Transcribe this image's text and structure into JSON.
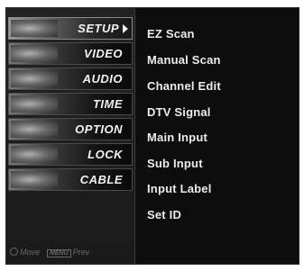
{
  "left_menu": {
    "items": [
      {
        "label": "SETUP",
        "icon": "setup-thumb-icon",
        "selected": true
      },
      {
        "label": "VIDEO",
        "icon": "video-thumb-icon"
      },
      {
        "label": "AUDIO",
        "icon": "audio-thumb-icon"
      },
      {
        "label": "TIME",
        "icon": "time-thumb-icon"
      },
      {
        "label": "OPTION",
        "icon": "option-thumb-icon"
      },
      {
        "label": "LOCK",
        "icon": "lock-thumb-icon"
      },
      {
        "label": "CABLE",
        "icon": "cable-thumb-icon"
      }
    ],
    "selected_arrow": "chevron-right-icon"
  },
  "footer": {
    "move_label": "Move",
    "menu_key": "MENU",
    "prev_label": "Prev"
  },
  "sub_menu": {
    "items": [
      "EZ Scan",
      "Manual Scan",
      "Channel Edit",
      "DTV Signal",
      "Main Input",
      "Sub Input",
      "Input Label",
      "Set ID"
    ]
  },
  "colors": {
    "background": "#0d0d0d",
    "text": "#ececec",
    "footer_text": "#6a6a6a"
  }
}
